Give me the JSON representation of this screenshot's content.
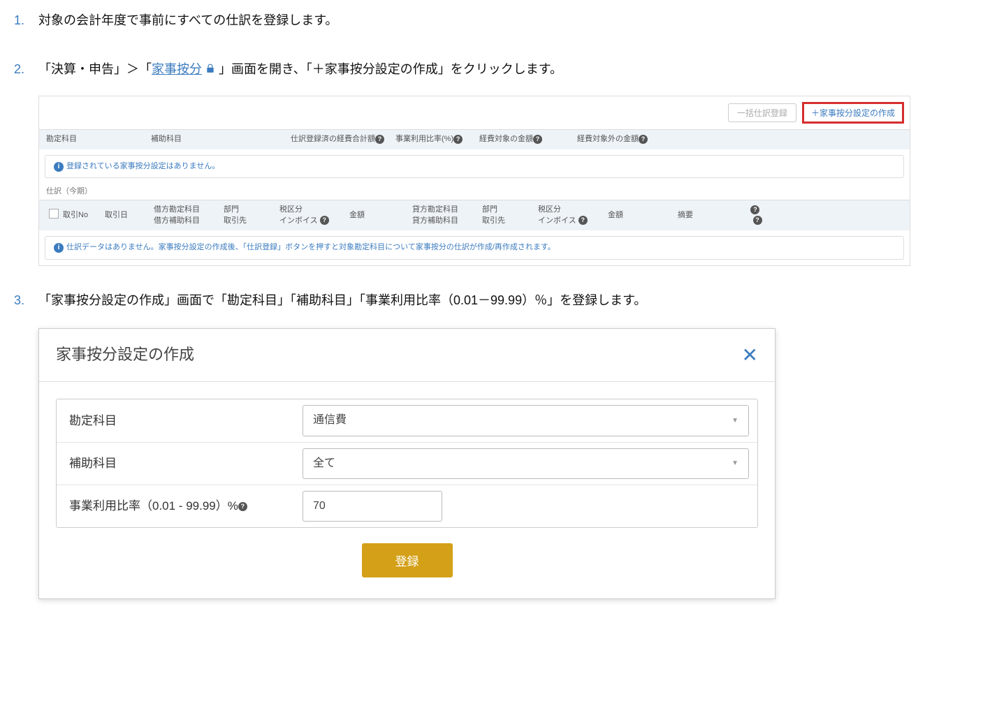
{
  "steps": {
    "s1": "対象の会計年度で事前にすべての仕訳を登録します。",
    "s2_pre": "「決算・申告」＞「",
    "s2_link": "家事按分",
    "s2_post": "」画面を開き、「＋家事按分設定の作成」をクリックします。",
    "s3": "「家事按分設定の作成」画面で「勘定科目」「補助科目」「事業利用比率（0.01－99.99）％」を登録します。"
  },
  "shot1": {
    "btn_bulk": "一括仕訳登録",
    "btn_create": "＋家事按分設定の作成",
    "cols": {
      "kanjo": "勘定科目",
      "hojo": "補助科目",
      "keihi": "仕訳登録済の経費合計額",
      "riyou": "事業利用比率(%)",
      "taisho": "経費対象の金額",
      "gaito": "経費対象外の金額"
    },
    "info1": "登録されている家事按分設定はありません。",
    "section": "仕訳（今期）",
    "detail_cols": {
      "torihikino": "取引No",
      "torihikibi": "取引日",
      "karikata1": "借方勘定科目",
      "karikata2": "借方補助科目",
      "bumon1": "部門",
      "bumon2": "取引先",
      "zeikubun1": "税区分",
      "zeikubun2": "インボイス",
      "kingaku": "金額",
      "kashikata1": "貸方勘定科目",
      "kashikata2": "貸方補助科目",
      "tekiyo": "摘要"
    },
    "info2": "仕訳データはありません。家事按分設定の作成後、「仕訳登録」ボタンを押すと対象勘定科目について家事按分の仕訳が作成/再作成されます。"
  },
  "shot2": {
    "title": "家事按分設定の作成",
    "label_kanjo": "勘定科目",
    "value_kanjo": "通信費",
    "label_hojo": "補助科目",
    "value_hojo": "全て",
    "label_ratio": "事業利用比率（0.01 - 99.99）%",
    "value_ratio": "70",
    "submit": "登録"
  }
}
